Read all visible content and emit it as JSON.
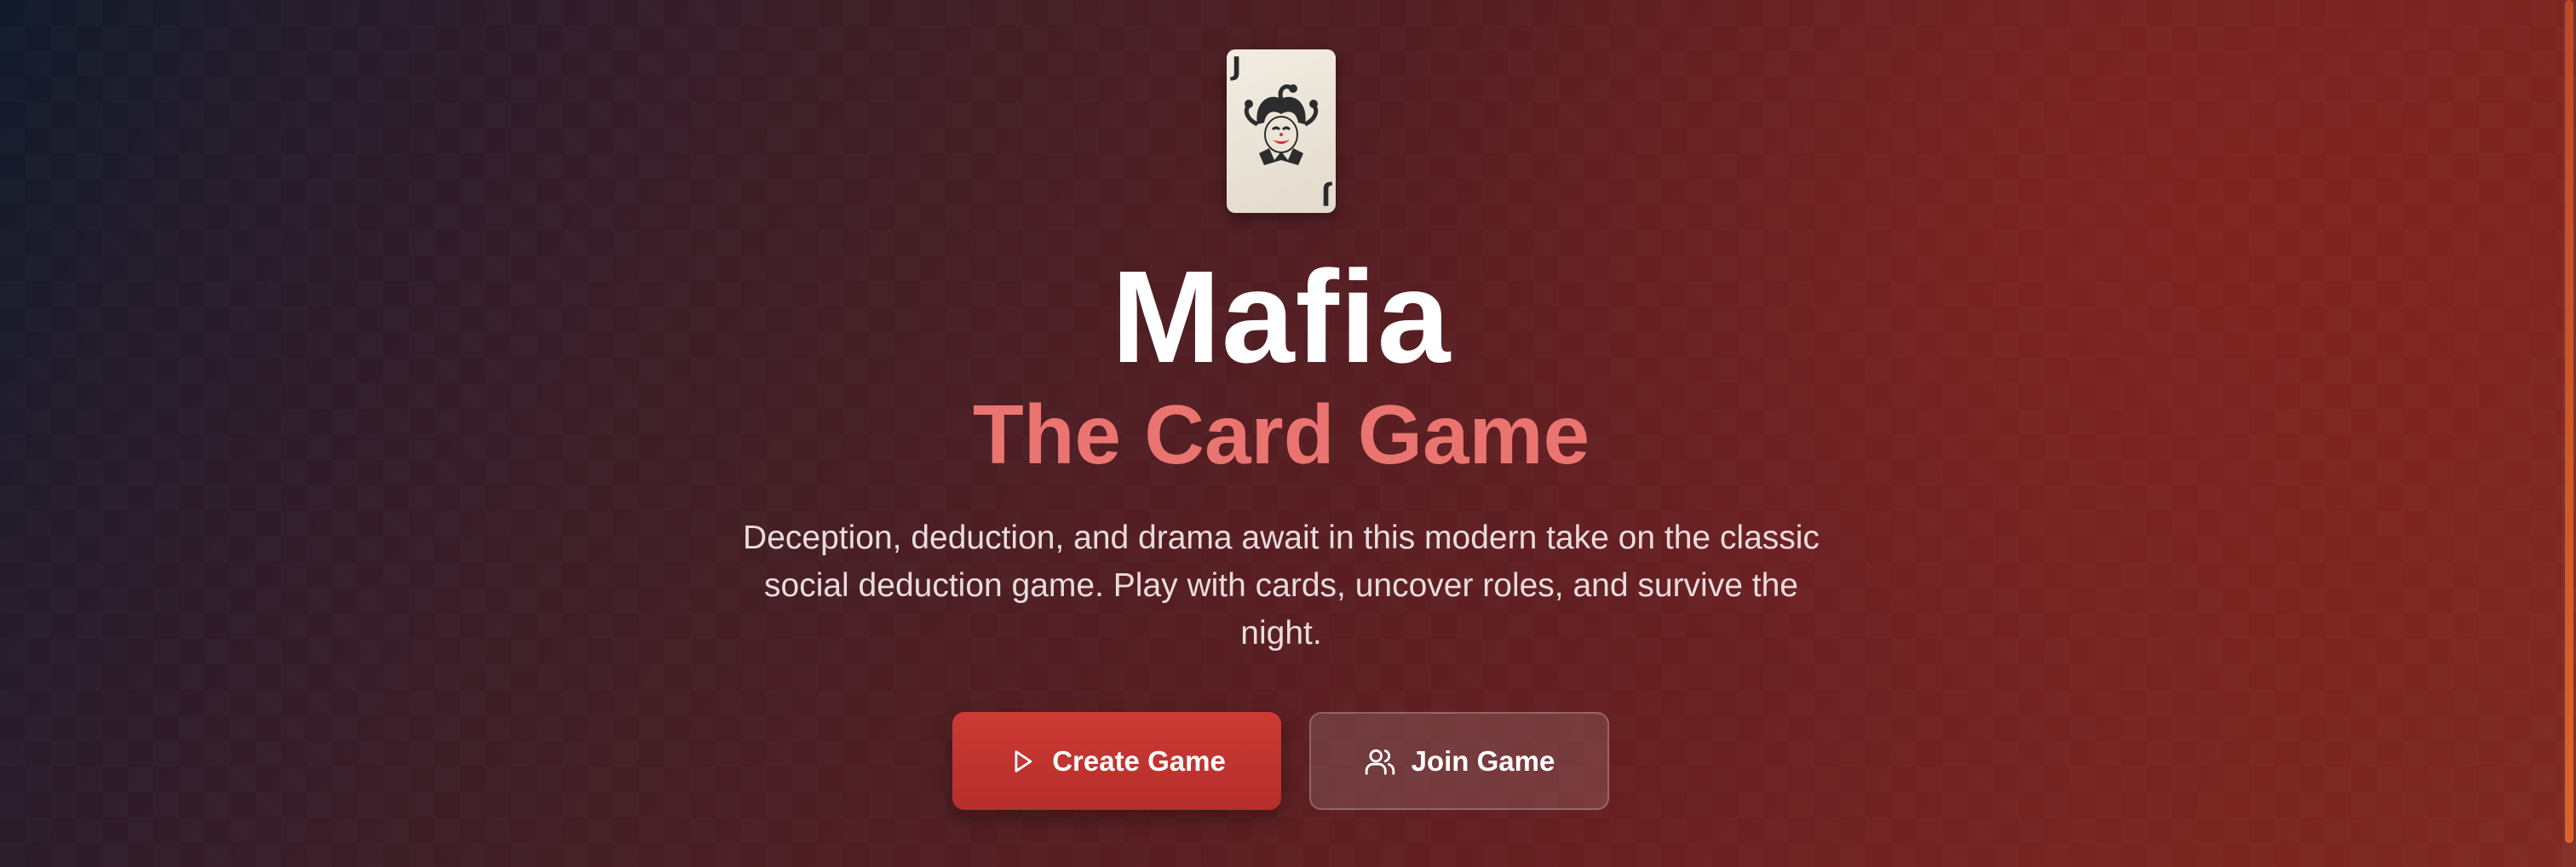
{
  "hero": {
    "card": {
      "corner_label": "J",
      "icon": "jester-icon"
    },
    "title": "Mafia",
    "subtitle": "The Card Game",
    "description": "Deception, deduction, and drama await in this modern take on the classic social deduction game. Play with cards, uncover roles, and survive the night."
  },
  "actions": {
    "create": {
      "label": "Create Game",
      "icon": "play-icon"
    },
    "join": {
      "label": "Join Game",
      "icon": "users-icon"
    }
  },
  "colors": {
    "title": "#ffffff",
    "subtitle": "#ea7470",
    "primary_button": "#c1342f",
    "scroll_thumb": "#d9632a"
  }
}
